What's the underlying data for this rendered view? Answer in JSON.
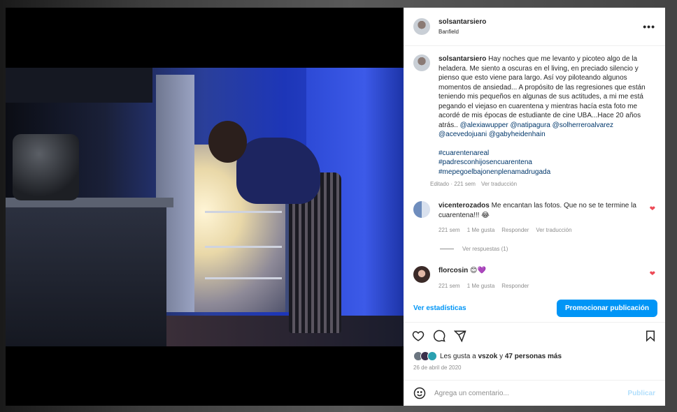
{
  "post": {
    "username": "solsantarsiero",
    "location": "Banfield",
    "more_icon": "more-horizontal-icon",
    "caption": {
      "username": "solsantarsiero",
      "text": "Hay noches que me levanto y picoteo algo de la heladera. Me siento a oscuras en el living, en preciado silencio y pienso que esto viene para largo. Así voy piloteando algunos momentos de ansiedad... A propósito de las regresiones que están teniendo mis pequeños en algunas de sus actitudes, a mi me está pegando el viejaso en cuarentena y mientras hacía esta foto me acordé de mis épocas de estudiante de cine UBA...Hace 20 años atrás..",
      "mentions": [
        "@alexiawupper",
        "@natipagura",
        "@solherreroalvarez",
        "@acevedojuani",
        "@gabyheidenhain"
      ],
      "hashtags": [
        "#cuarentenareal",
        "#padresconhijosencuarentena",
        "#mepegoelbajonenplenamadrugada"
      ],
      "edited": "Editado",
      "time": "221 sem",
      "translate": "Ver traducción"
    },
    "comments": [
      {
        "username": "vicenterozados",
        "text": "Me encantan las fotos. Que no se te termine la cuarentena!!! 😂",
        "time": "221 sem",
        "likes": "1 Me gusta",
        "reply": "Responder",
        "translate": "Ver traducción",
        "view_replies": "Ver respuestas (1)"
      },
      {
        "username": "florcosin",
        "text": "😊💜",
        "time": "221 sem",
        "likes": "1 Me gusta",
        "reply": "Responder"
      }
    ],
    "stats_link": "Ver estadísticas",
    "promote_button": "Promocionar publicación",
    "likes_text_prefix": "Les gusta a",
    "likes_user": "vszok",
    "likes_text_mid": "y",
    "likes_others": "47 personas más",
    "date": "26 de abril de 2020",
    "comment_placeholder": "Agrega un comentario...",
    "publish_label": "Publicar"
  },
  "colors": {
    "link": "#00376b",
    "accent": "#0095f6",
    "heart": "#ed4956",
    "muted": "#8e8e8e"
  }
}
